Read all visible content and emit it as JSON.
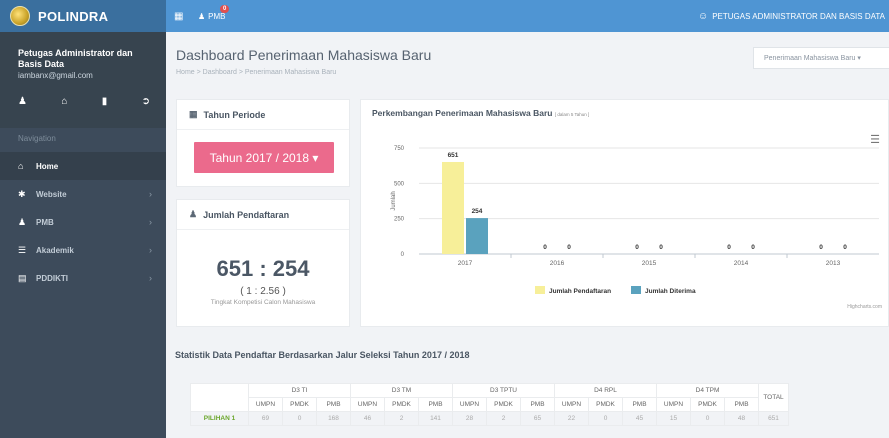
{
  "app": {
    "brand": "POLINDRA"
  },
  "profile": {
    "name": "Petugas Administrator dan Basis Data",
    "email": "iambanx@gmail.com"
  },
  "nav": {
    "label": "Navigation",
    "items": [
      {
        "label": "Home",
        "icon": "home-icon"
      },
      {
        "label": "Website",
        "icon": "globe-icon"
      },
      {
        "label": "PMB",
        "icon": "users-icon"
      },
      {
        "label": "Akademik",
        "icon": "list-icon"
      },
      {
        "label": "PDDIKTI",
        "icon": "book-icon"
      }
    ]
  },
  "topbar": {
    "pmb_label": "PMB",
    "pmb_badge": "0",
    "user": "PETUGAS ADMINISTRATOR DAN BASIS DATA"
  },
  "page": {
    "title": "Dashboard Penerimaan Mahasiswa Baru",
    "breadcrumb": "Home  >  Dashboard  >  Penerimaan Mahasiswa Baru",
    "dropdown": "Penerimaan Mahasiswa Baru ▾"
  },
  "periode": {
    "title": "Tahun Periode",
    "button": "Tahun 2017 / 2018 ▾"
  },
  "pendaftaran": {
    "title": "Jumlah Pendaftaran",
    "ratio": "651 : 254",
    "ratio_small": "( 1 : 2.56 )",
    "caption": "Tingkat Kompetisi Calon Mahasiswa"
  },
  "chart_title": "Perkembangan Penerimaan Mahasiswa Baru",
  "chart_subtitle": "[ dalam 5 Tahun ]",
  "chart_credit": "Highcharts.com",
  "chart_data": {
    "type": "bar",
    "categories": [
      "2017",
      "2016",
      "2015",
      "2014",
      "2013"
    ],
    "series": [
      {
        "name": "Jumlah Pendaftaran",
        "values": [
          651,
          0,
          0,
          0,
          0
        ],
        "color": "#f7ef99"
      },
      {
        "name": "Jumlah Diterima",
        "values": [
          254,
          0,
          0,
          0,
          0
        ],
        "color": "#5aa2be"
      }
    ],
    "ylabel": "Jumlah",
    "yticks": [
      0,
      250,
      500,
      750
    ],
    "ylim": [
      0,
      750
    ],
    "grid": true,
    "legend": "bottom"
  },
  "stat": {
    "title": "Statistik Data Pendaftar Berdasarkan Jalur Seleksi Tahun 2017 / 2018",
    "groups": [
      "D3 TI",
      "D3 TM",
      "D3 TPTU",
      "D4 RPL",
      "D4 TPM"
    ],
    "subcols": [
      "UMPN",
      "PMDK",
      "PMB"
    ],
    "total_label": "TOTAL",
    "rows": [
      {
        "label": "PILIHAN 1",
        "values": [
          "69",
          "0",
          "168",
          "46",
          "2",
          "141",
          "28",
          "2",
          "65",
          "22",
          "0",
          "45",
          "15",
          "0",
          "48",
          "651"
        ]
      }
    ]
  }
}
